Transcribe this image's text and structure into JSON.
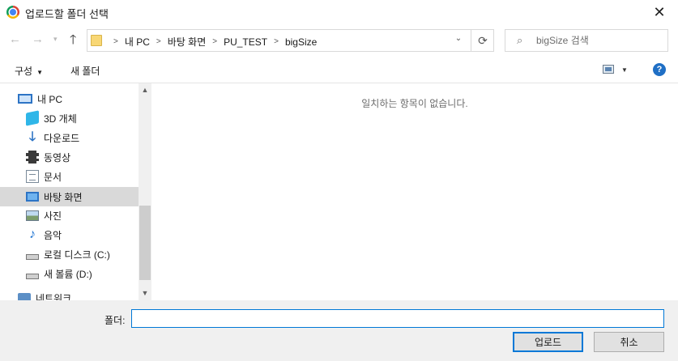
{
  "window": {
    "title": "업로드할 폴더 선택",
    "close_glyph": "✕"
  },
  "nav": {
    "back_glyph": "←",
    "forward_glyph": "→",
    "recent_glyph": "▾",
    "up_glyph": "🡑",
    "breadcrumb": [
      "내 PC",
      "바탕 화면",
      "PU_TEST",
      "bigSize"
    ],
    "dropdown_glyph": "⌄",
    "refresh_glyph": "⟳",
    "search_placeholder": "bigSize 검색"
  },
  "toolbar": {
    "organize_label": "구성",
    "new_folder_label": "새 폴더",
    "help_label": "?"
  },
  "sidebar": {
    "items": [
      {
        "label": "내 PC",
        "icon": "pc-icon"
      },
      {
        "label": "3D 개체",
        "icon": "3d-objects-icon"
      },
      {
        "label": "다운로드",
        "icon": "download-icon"
      },
      {
        "label": "동영상",
        "icon": "video-icon"
      },
      {
        "label": "문서",
        "icon": "document-icon"
      },
      {
        "label": "바탕 화면",
        "icon": "desktop-icon",
        "selected": true
      },
      {
        "label": "사진",
        "icon": "pictures-icon"
      },
      {
        "label": "음악",
        "icon": "music-icon"
      },
      {
        "label": "로컬 디스크 (C:)",
        "icon": "drive-icon"
      },
      {
        "label": "새 볼륨 (D:)",
        "icon": "drive-icon"
      },
      {
        "label": "네트워크",
        "icon": "network-icon"
      }
    ]
  },
  "main": {
    "empty_message": "일치하는 항목이 없습니다."
  },
  "footer": {
    "folder_label": "폴더:",
    "folder_value": "",
    "upload_label": "업로드",
    "cancel_label": "취소"
  },
  "colors": {
    "accent": "#0078d7",
    "selected_bg": "#d9d9d9",
    "footer_bg": "#f0f0f0"
  }
}
